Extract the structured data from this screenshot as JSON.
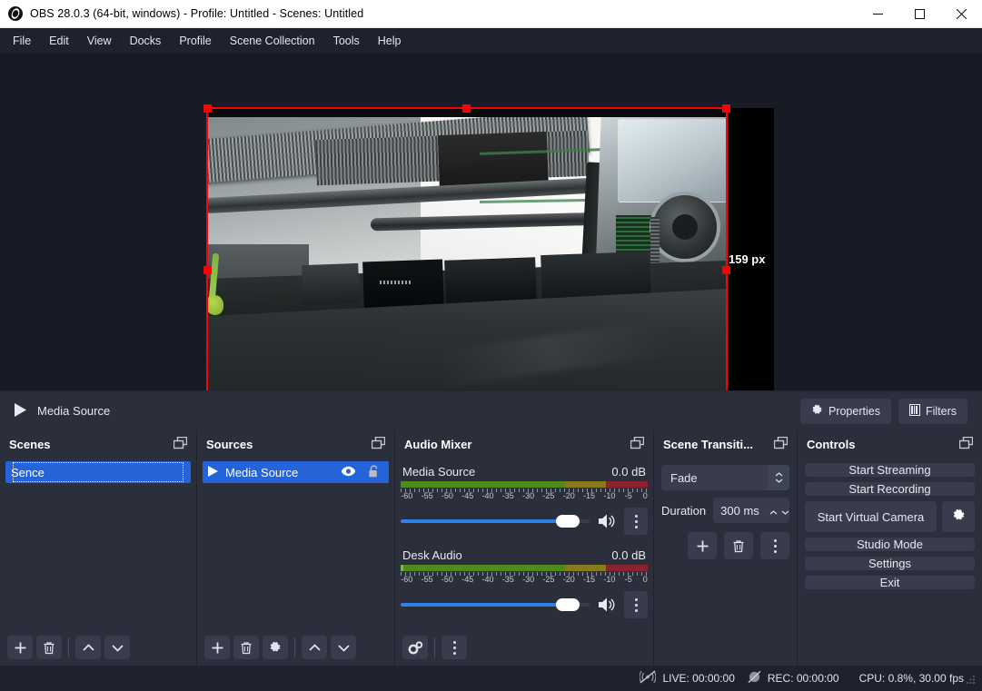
{
  "window": {
    "title": "OBS 28.0.3 (64-bit, windows) - Profile: Untitled - Scenes: Untitled",
    "logo_icon": "obs-logo-icon",
    "minimize_label": "—",
    "maximize_label": "□",
    "close_label": "✕"
  },
  "menu": {
    "items": [
      {
        "label": "File"
      },
      {
        "label": "Edit"
      },
      {
        "label": "View"
      },
      {
        "label": "Docks"
      },
      {
        "label": "Profile"
      },
      {
        "label": "Scene Collection"
      },
      {
        "label": "Tools"
      },
      {
        "label": "Help"
      }
    ]
  },
  "preview": {
    "size_label": "159 px",
    "selection_color": "#ff0000",
    "background_color": "#181b25",
    "canvas_color": "#000000"
  },
  "source_toolbar": {
    "play_icon": "play-icon",
    "source_name": "Media Source",
    "properties_label": "Properties",
    "properties_icon": "gear-icon",
    "filters_label": "Filters",
    "filters_icon": "filters-icon"
  },
  "scenes": {
    "title": "Scenes",
    "float_icon": "float-dock-icon",
    "items": [
      {
        "label": "Sence",
        "selected": true
      }
    ],
    "toolbar": [
      {
        "name": "add-scene-button",
        "icon": "plus-icon"
      },
      {
        "name": "remove-scene-button",
        "icon": "trash-icon"
      },
      {
        "name": "move-scene-up-button",
        "icon": "chevron-up-icon"
      },
      {
        "name": "move-scene-down-button",
        "icon": "chevron-down-icon"
      }
    ]
  },
  "sources": {
    "title": "Sources",
    "float_icon": "float-dock-icon",
    "items": [
      {
        "label": "Media Source",
        "selected": true,
        "visible_icon": "eye-icon",
        "lock_icon": "unlock-icon"
      }
    ],
    "toolbar": [
      {
        "name": "add-source-button",
        "icon": "plus-icon"
      },
      {
        "name": "remove-source-button",
        "icon": "trash-icon"
      },
      {
        "name": "source-properties-button",
        "icon": "gear-icon"
      },
      {
        "name": "move-source-up-button",
        "icon": "chevron-up-icon"
      },
      {
        "name": "move-source-down-button",
        "icon": "chevron-down-icon"
      }
    ]
  },
  "mixer": {
    "title": "Audio Mixer",
    "float_icon": "float-dock-icon",
    "scale_ticks": [
      "-60",
      "-55",
      "-50",
      "-45",
      "-40",
      "-35",
      "-30",
      "-25",
      "-20",
      "-15",
      "-10",
      "-5",
      "0"
    ],
    "channels": [
      {
        "name": "Media Source",
        "db": "0.0 dB",
        "volume_percent": 100,
        "mute_icon": "speaker-on-icon",
        "menu_icon": "vertical-dots-icon"
      },
      {
        "name": "Desk Audio",
        "db": "0.0 dB",
        "volume_percent": 100,
        "mute_icon": "speaker-on-icon",
        "menu_icon": "vertical-dots-icon"
      }
    ],
    "toolbar": [
      {
        "name": "advanced-audio-properties-button",
        "icon": "double-gear-icon"
      },
      {
        "name": "mixer-menu-button",
        "icon": "vertical-dots-icon"
      }
    ]
  },
  "transitions": {
    "title": "Scene Transiti...",
    "float_icon": "float-dock-icon",
    "transition": "Fade",
    "duration_label": "Duration",
    "duration_value": "300 ms",
    "buttons": [
      {
        "name": "add-transition-button",
        "icon": "plus-icon"
      },
      {
        "name": "remove-transition-button",
        "icon": "trash-icon"
      },
      {
        "name": "transition-menu-button",
        "icon": "vertical-dots-icon"
      }
    ]
  },
  "controls": {
    "title": "Controls",
    "float_icon": "float-dock-icon",
    "start_streaming": "Start Streaming",
    "start_recording": "Start Recording",
    "start_virtual_camera": "Start Virtual Camera",
    "virtual_camera_settings_icon": "gear-icon",
    "studio_mode": "Studio Mode",
    "settings": "Settings",
    "exit": "Exit"
  },
  "statusbar": {
    "live_icon": "broadcast-off-icon",
    "live": "LIVE: 00:00:00",
    "rec_icon": "record-off-icon",
    "rec": "REC: 00:00:00",
    "cpu": "CPU: 0.8%, 30.00 fps",
    "grip_icon": "resize-grip-icon"
  }
}
